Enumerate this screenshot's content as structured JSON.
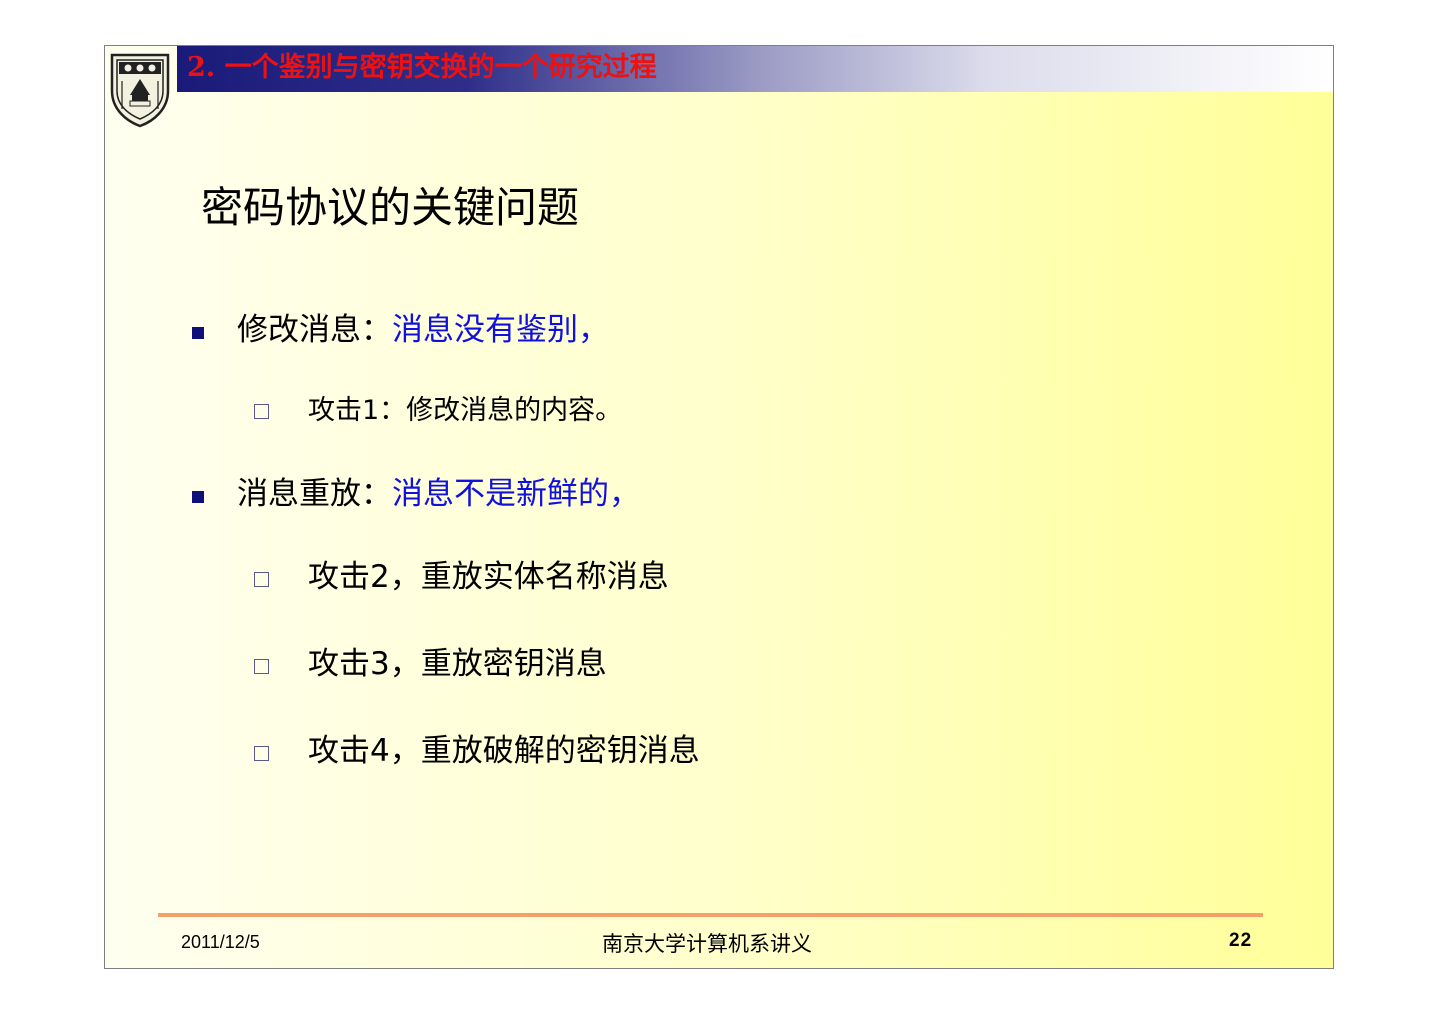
{
  "header": {
    "title": "2. 一个鉴别与密钥交换的一个研究过程",
    "logo_icon": "nanjing-university-crest-icon",
    "title_color": "#ee1111",
    "bar_color": "#1a1a7a"
  },
  "slide": {
    "title": "密码协议的关键问题",
    "background_color": "#ffff99"
  },
  "bullets": [
    {
      "label": "修改消息：",
      "highlight": "消息没有鉴别，",
      "subitems": [
        {
          "text": "攻击1：修改消息的内容。"
        }
      ]
    },
    {
      "label": "消息重放：",
      "highlight": "消息不是新鲜的，",
      "subitems": [
        {
          "text": "攻击2，重放实体名称消息"
        },
        {
          "text": "攻击3，重放密钥消息"
        },
        {
          "text": "攻击4，重放破解的密钥消息"
        }
      ]
    }
  ],
  "footer": {
    "date": "2011/12/5",
    "center": "南京大学计算机系讲义",
    "page": "22",
    "line_color": "#f5a06a"
  }
}
